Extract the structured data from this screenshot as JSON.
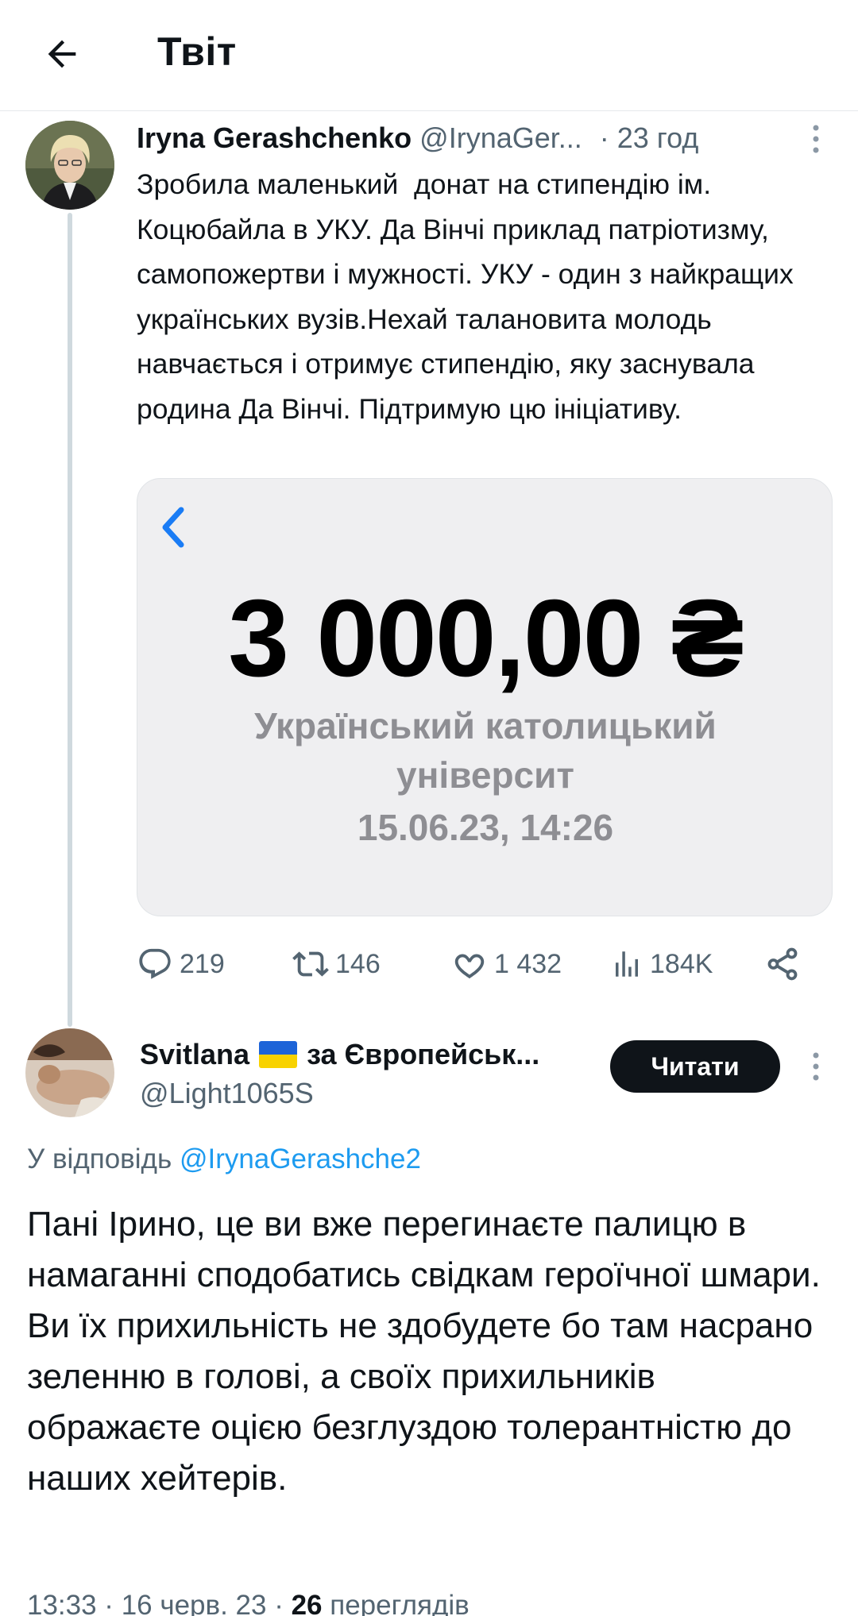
{
  "header": {
    "title": "Твіт",
    "back_icon": "arrow-left-icon"
  },
  "tweet": {
    "author_name": "Iryna Gerashchenko",
    "author_handle": "@IrynaGer...",
    "time": "· 23 год",
    "text": "Зробила маленький  донат на стипендію ім. Коцюбайла в УКУ. Да Вінчі приклад патріотизму, самопожертви і мужності. УКУ - один з найкращих українських вузів.Нехай талановита молодь навчається і отримує стипендію, яку заснувала родина Да Вінчі. Підтримую цю ініціативу.",
    "media": {
      "amount": "3 000,00 ₴",
      "recipient_line1": "Український католицький",
      "recipient_line2": "університ",
      "datetime": "15.06.23, 14:26",
      "accent": "#1a7cf5"
    },
    "actions": {
      "replies": "219",
      "retweets": "146",
      "likes": "1 432",
      "views": "184K"
    }
  },
  "reply": {
    "author_name_pre": "Svitlana",
    "author_name_post": "за Європейськ...",
    "author_handle": "@Light1065S",
    "follow_label": "Читати",
    "reply_to_prefix": "У відповідь",
    "reply_to_mention": "@IrynaGerashche2",
    "text": "Пані Ірино, це ви вже перегинаєте палицю в намаганні сподобатись свідкам героїчної шмари. Ви їх прихильність не здобудете бо там насрано зеленню в голові, а своїх прихильників ображаєте оцією безглуздою толерантністю до наших хейтерів.",
    "meta_time": "13:33 · 16 черв. 23 · ",
    "meta_views_count": "26",
    "meta_views_label": " переглядів"
  },
  "colors": {
    "link": "#1d9bf0",
    "secondary_text": "#536471",
    "button_bg": "#0f1419"
  }
}
